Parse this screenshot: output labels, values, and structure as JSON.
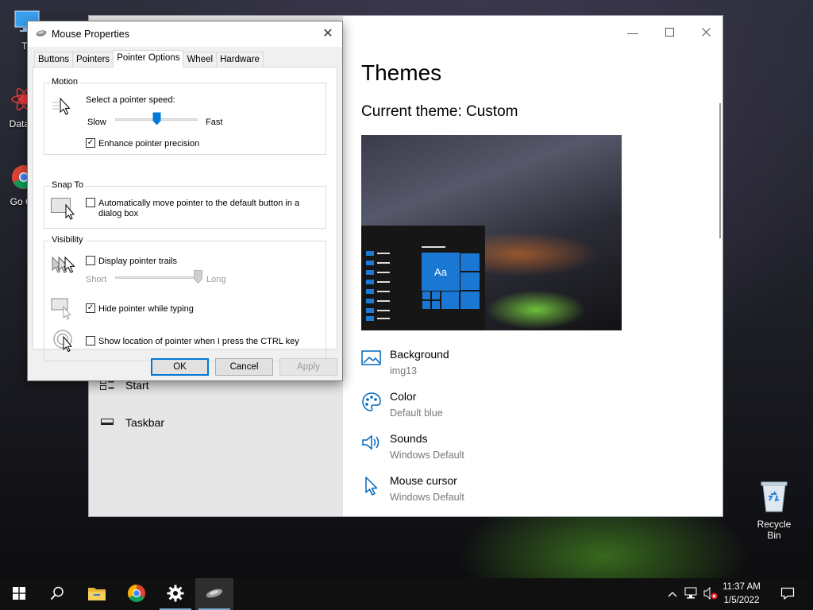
{
  "desktop": {
    "icons": [
      {
        "label": "Th",
        "icon": "this-pc-icon"
      },
      {
        "label": "DataW",
        "icon": "datawrapper-icon"
      },
      {
        "label": "Go Ch",
        "icon": "chrome-icon"
      }
    ],
    "recycle_bin": {
      "label": "Recycle Bin",
      "icon": "recycle-bin-icon"
    }
  },
  "settings": {
    "nav": [
      {
        "label": "Start",
        "icon": "start-icon"
      },
      {
        "label": "Taskbar",
        "icon": "taskbar-icon"
      }
    ],
    "title": "Themes",
    "current_theme": "Current theme: Custom",
    "preview": {
      "tile_label": "Aa"
    },
    "items": [
      {
        "label": "Background",
        "value": "img13",
        "icon": "background-icon"
      },
      {
        "label": "Color",
        "value": "Default blue",
        "icon": "palette-icon"
      },
      {
        "label": "Sounds",
        "value": "Windows Default",
        "icon": "speaker-icon"
      },
      {
        "label": "Mouse cursor",
        "value": "Windows Default",
        "icon": "cursor-icon"
      }
    ],
    "accent": "#0067c0"
  },
  "dialog": {
    "title": "Mouse Properties",
    "tabs": [
      "Buttons",
      "Pointers",
      "Pointer Options",
      "Wheel",
      "Hardware"
    ],
    "active_tab": "Pointer Options",
    "motion": {
      "legend": "Motion",
      "speed_label": "Select a pointer speed:",
      "slow": "Slow",
      "fast": "Fast",
      "speed_level": 0.5,
      "enhance_label": "Enhance pointer precision",
      "enhance_checked": true
    },
    "snap_to": {
      "legend": "Snap To",
      "label_line1": "Automatically move pointer to the default button in a",
      "label_line2": "dialog box",
      "checked": false
    },
    "visibility": {
      "legend": "Visibility",
      "trails_label": "Display pointer trails",
      "trails_checked": false,
      "short": "Short",
      "long": "Long",
      "trail_level": 1.0,
      "hide_label": "Hide pointer while typing",
      "hide_checked": true,
      "ctrl_label": "Show location of pointer when I press the CTRL key",
      "ctrl_checked": false
    },
    "buttons": {
      "ok": "OK",
      "cancel": "Cancel",
      "apply": "Apply"
    }
  },
  "taskbar": {
    "apps": [
      "start-icon",
      "search-icon",
      "file-explorer-icon",
      "chrome-icon",
      "settings-icon",
      "mouse-icon"
    ],
    "time": "11:37 AM",
    "date": "1/5/2022"
  }
}
